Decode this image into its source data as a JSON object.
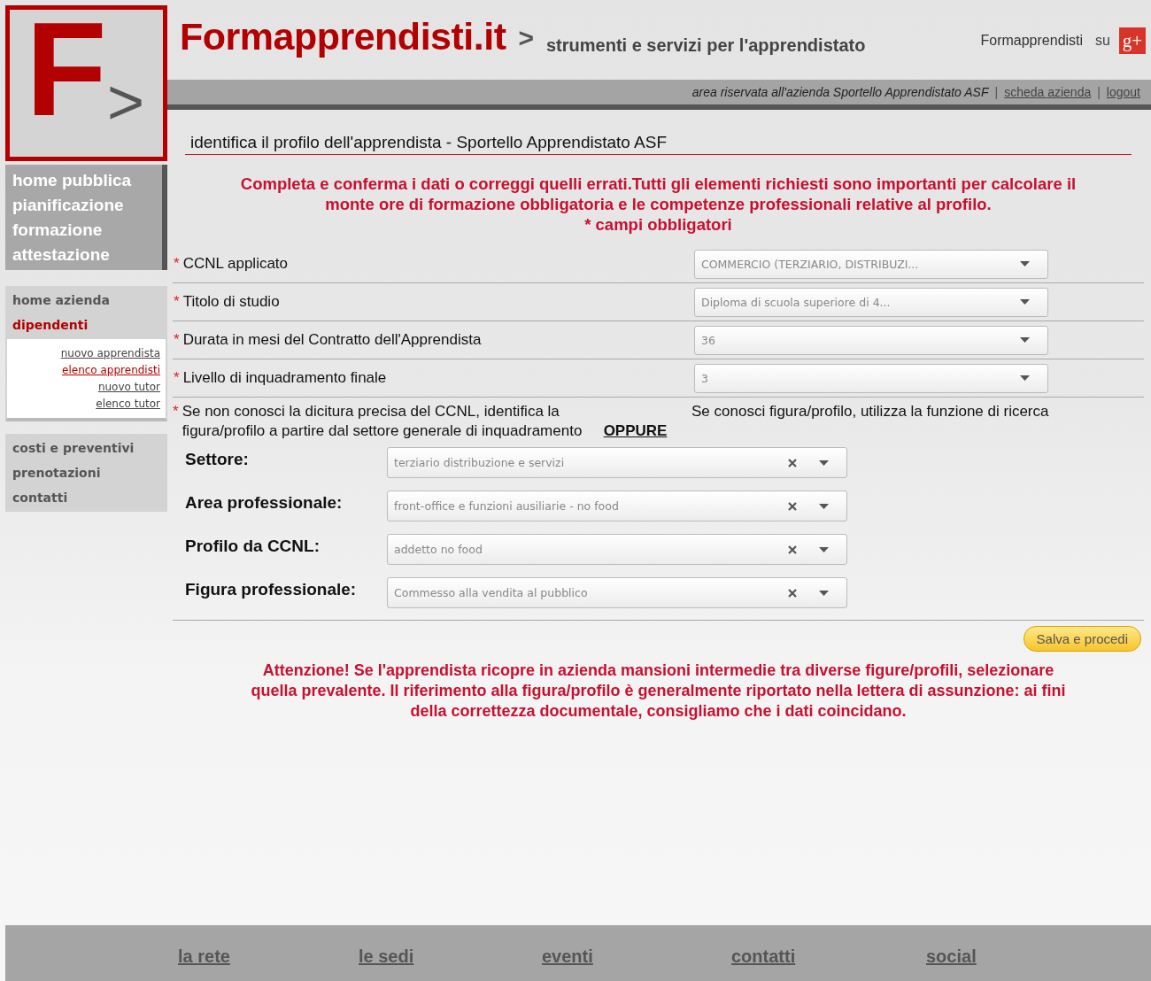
{
  "logo": {
    "letter": "F",
    "mark": ">"
  },
  "header": {
    "brand": "Formapprendisti.it",
    "separator": ">",
    "tagline": "strumenti e servizi per l'apprendistato",
    "social_label": "Formapprendisti",
    "social_suffix": "su",
    "social_icon": "g+"
  },
  "userbar": {
    "text": "area riservata all'azienda Sportello Apprendistato ASF",
    "separator": "|",
    "links": [
      "scheda azienda",
      "logout"
    ]
  },
  "sidebar": {
    "public_menu": [
      "home pubblica",
      "pianificazione",
      "formazione",
      "attestazione"
    ],
    "company_menu": [
      {
        "label": "home azienda",
        "selected": false
      },
      {
        "label": "dipendenti",
        "selected": true
      }
    ],
    "submenu": [
      {
        "label": "nuovo apprendista",
        "selected": false
      },
      {
        "label": "elenco apprendisti",
        "selected": true
      },
      {
        "label": "nuovo tutor",
        "selected": false
      },
      {
        "label": "elenco tutor",
        "selected": false
      }
    ],
    "extra_menu": [
      "costi e preventivi",
      "prenotazioni",
      "contatti"
    ]
  },
  "main": {
    "title": "identifica il profilo dell'apprendista - Sportello Apprendistato ASF",
    "intro": "Completa e conferma i dati o correggi quelli errati.Tutti gli elementi richiesti sono importanti per calcolare il monte ore di formazione obbligatoria e le competenze professionali relative al profilo.",
    "required_marker": "*",
    "required_note": "campi obbligatori",
    "fields": [
      {
        "label": "CCNL applicato",
        "required": true,
        "value": "COMMERCIO (TERZIARIO, DISTRIBUZI..."
      },
      {
        "label": "Titolo di studio",
        "required": true,
        "value": "Diploma di scuola superiore di 4..."
      },
      {
        "label": "Durata in mesi del Contratto dell'Apprendista",
        "required": true,
        "value": "36"
      },
      {
        "label": "Livello di inquadramento finale",
        "required": true,
        "value": "3"
      }
    ],
    "hint": {
      "required": true,
      "text": "Se non conosci la dicitura precisa del CCNL, identifica la figura/profilo a partire dal settore generale di inquadramento",
      "link": "OPPURE",
      "search_hint": "Se conosci figura/profilo, utilizza la funzione di ricerca"
    },
    "search_fields": [
      {
        "label": "Settore:",
        "value": "terziario distribuzione e servizi"
      },
      {
        "label": "Area professionale:",
        "value": "front-office e funzioni ausiliarie - no food"
      },
      {
        "label": "Profilo da CCNL:",
        "value": "addetto no food"
      },
      {
        "label": "Figura professionale:",
        "value": "Commesso alla vendita al pubblico"
      }
    ],
    "submit": "Salva e procedi",
    "warning": "Attenzione! Se l'apprendista ricopre in azienda mansioni intermedie tra diverse figure/profili, selezionare quella prevalente. Il riferimento alla figura/profilo è generalmente riportato nella lettera di assunzione: ai fini della correttezza documentale, consigliamo che i dati coincidano."
  },
  "footer": [
    "la rete",
    "le sedi",
    "eventi",
    "contatti",
    "social"
  ]
}
